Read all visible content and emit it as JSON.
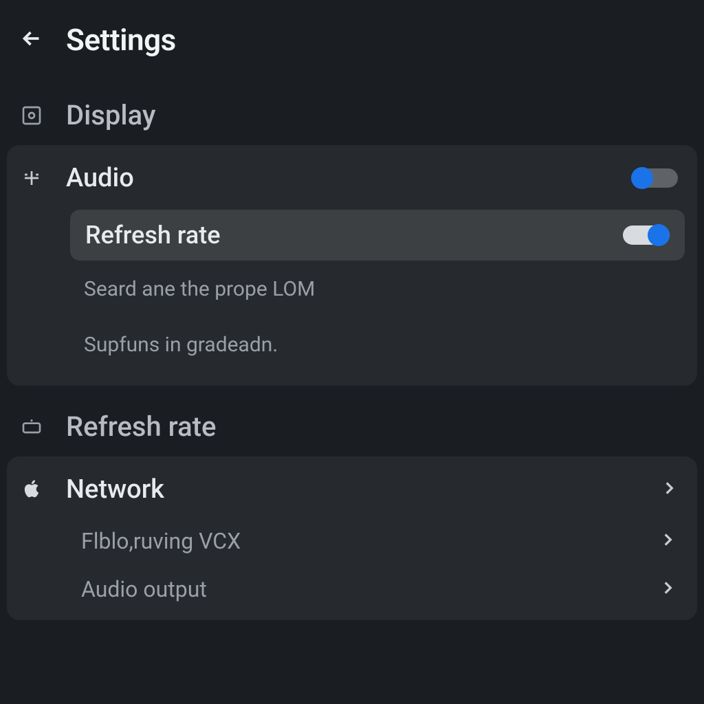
{
  "header": {
    "title": "Settings"
  },
  "sections": {
    "display": {
      "title": "Display",
      "rows": {
        "audio": {
          "label": "Audio"
        },
        "refresh_rate": {
          "label": "Refresh rate"
        },
        "subtext1": "Seard ane the prope LOM",
        "subtext2": "Supfuns in gradeadn."
      }
    },
    "refresh": {
      "title": "Refresh rate",
      "rows": {
        "network": {
          "label": "Network"
        },
        "sub1": {
          "label": "Flblo,ruving VCX"
        },
        "sub2": {
          "label": "Audio output"
        }
      }
    }
  }
}
